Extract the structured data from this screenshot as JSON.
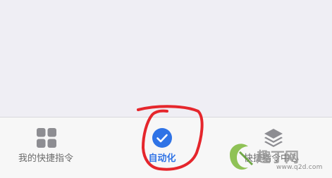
{
  "tab_bar": {
    "tabs": [
      {
        "label": "我的快捷指令",
        "icon": "grid-icon",
        "active": false
      },
      {
        "label": "自动化",
        "icon": "clock-check-icon",
        "active": true
      },
      {
        "label": "快捷指令中心",
        "icon": "layers-icon",
        "active": false
      }
    ]
  },
  "colors": {
    "background": "#efeef4",
    "tab_bar": "#f7f7f7",
    "active_accent": "#2f73e6",
    "inactive": "#6b6b6b",
    "annotation": "#e5262c"
  },
  "watermark": {
    "logo_text": "趣丁网",
    "url": "www.q2d.com"
  }
}
